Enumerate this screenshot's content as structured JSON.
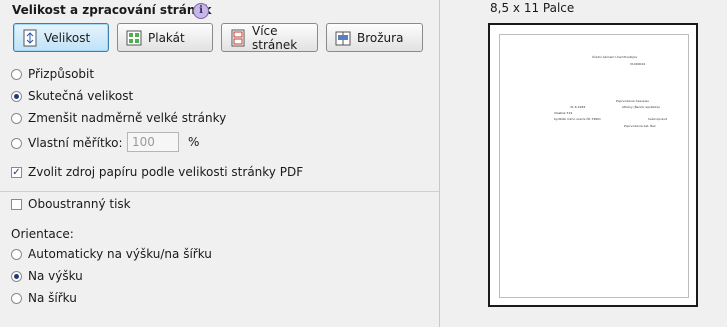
{
  "section": {
    "title": "Velikost a zpracování stránek",
    "info_icon": "info-icon"
  },
  "mode_buttons": [
    {
      "label": "Velikost",
      "icon": "page-size-icon",
      "active": true
    },
    {
      "label": "Plakát",
      "icon": "poster-icon",
      "active": false
    },
    {
      "label": "Více stránek",
      "icon": "multiple-pages-icon",
      "active": false
    },
    {
      "label": "Brožura",
      "icon": "booklet-icon",
      "active": false
    }
  ],
  "sizing_options": [
    {
      "label": "Přizpůsobit",
      "checked": false
    },
    {
      "label": "Skutečná velikost",
      "checked": true
    },
    {
      "label": "Zmenšit nadměrně velké stránky",
      "checked": false
    },
    {
      "label": "Vlastní měřítko:",
      "checked": false
    }
  ],
  "custom_scale": {
    "value": "100",
    "unit": "%"
  },
  "pdf_paper_source": {
    "label": "Zvolit zdroj papíru podle velikosti stránky PDF",
    "checked": true
  },
  "duplex": {
    "label": "Oboustranný tisk",
    "checked": false
  },
  "orientation": {
    "label": "Orientace:",
    "options": [
      {
        "label": "Automaticky na výšku/na šířku",
        "checked": false
      },
      {
        "label": "Na výšku",
        "checked": true
      },
      {
        "label": "Na šířku",
        "checked": false
      }
    ]
  },
  "preview": {
    "paper_size": "8,5 x 11 Palce",
    "lines": [
      "Úřední záznam Úrad Prostějov",
      "31000024",
      "Poprvodenia Časopisu",
      "31.6.1983",
      "Athény (Řecká republika)",
      "Vlastisk 319",
      "bydliště mimo území ČR 79801",
      "Svěd.úpravit",
      "Poprvodenia kat. Řez"
    ]
  },
  "colors": {
    "panel_bg": "#f0f0f0",
    "active_button": "#bfe2f7",
    "radio_dot": "#1f3b70"
  }
}
